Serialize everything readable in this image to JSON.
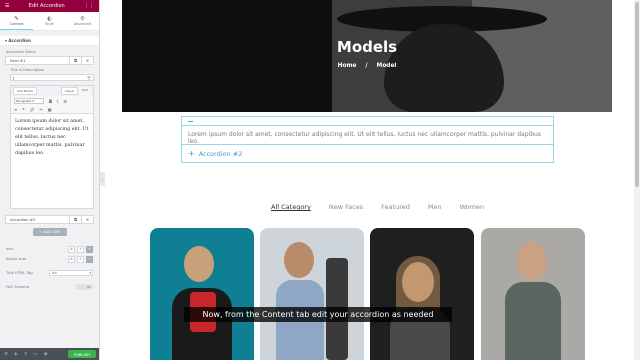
{
  "panel": {
    "header_title": "Edit Accordion",
    "tabs": [
      {
        "label": "Content",
        "icon": "pencil-icon"
      },
      {
        "label": "Style",
        "icon": "half-circle-icon"
      },
      {
        "label": "Advanced",
        "icon": "gear-icon"
      }
    ],
    "section_title": "Accordion",
    "items_label": "Accordion Items",
    "item1_title": "Item #1",
    "field_label": "Title & Description",
    "title_value": "|",
    "add_media": "Add Media",
    "visual_tab": "Visual",
    "text_tab": "Text",
    "format_select": "Paragraph",
    "description": "Lorem ipsum dolor sit amet, consectetur adipiscing elit. Ut elit tellus, luctus nec ullamcorper mattis, pulvinar dapibus leo.",
    "item2_title": "Accordion #2",
    "add_item": "+ ADD ITEM",
    "icon_label": "Icon",
    "active_icon_label": "Active Icon",
    "html_tag_label": "Title HTML Tag",
    "html_tag_value": "div",
    "faq_label": "FAQ Schema",
    "faq_value": "No",
    "publish": "PUBLISH"
  },
  "page": {
    "hero_title": "Models",
    "breadcrumb": [
      "Home",
      "/",
      "Model"
    ],
    "accordion_body": "Lorem ipsum dolor sit amet, consectetur adipiscing elit. Ut elit tellus, luctus nec ullamcorper mattis, pulvinar dapibus leo.",
    "accordion2_title": "Accordion #2",
    "categories": [
      "All Category",
      "New Faces",
      "Featured",
      "Men",
      "Women"
    ],
    "accent_color": "#93003c",
    "accordion_border": "#9bd5e8"
  },
  "caption": "Now, from the Content tab edit your accordion as needed"
}
